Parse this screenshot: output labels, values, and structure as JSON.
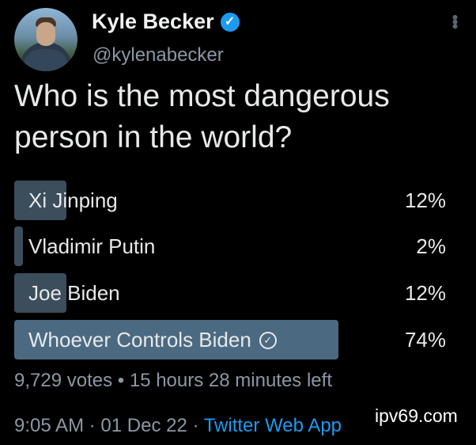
{
  "author": {
    "name": "Kyle Becker",
    "handle": "@kylenabecker",
    "verified_icon": "verified-badge-icon",
    "menu_icon": "more-options-icon"
  },
  "question": "Who is the most dangerous person in the world?",
  "poll": {
    "options": [
      {
        "label": "Xi Jinping",
        "percent": "12%",
        "value": 12
      },
      {
        "label": "Vladimir Putin",
        "percent": "2%",
        "value": 2
      },
      {
        "label": "Joe Biden",
        "percent": "12%",
        "value": 12
      },
      {
        "label": "Whoever Controls Biden",
        "percent": "74%",
        "value": 74,
        "selected": true
      }
    ],
    "votes": "9,729 votes",
    "separator": "•",
    "time_left": "15 hours 28 minutes left"
  },
  "footer": {
    "time": "9:05 AM",
    "date": "01 Dec 22",
    "separator": "·",
    "source": "Twitter Web App"
  },
  "watermark": "ipv69.com",
  "colors": {
    "background": "#000000",
    "bar": "#3c4d5c",
    "bar_selected": "#4b6a82",
    "link": "#1d9bf0"
  }
}
